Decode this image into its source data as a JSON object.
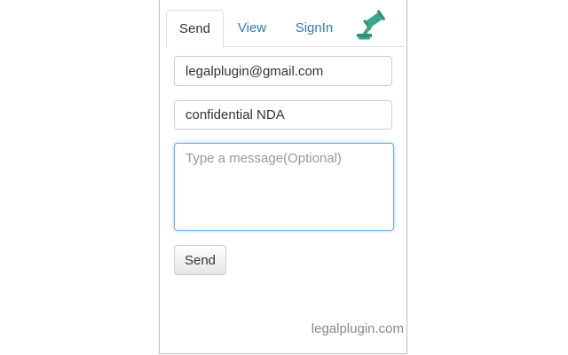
{
  "tabs": [
    {
      "label": "Send",
      "active": true
    },
    {
      "label": "View",
      "active": false
    },
    {
      "label": "SignIn",
      "active": false
    }
  ],
  "logo": {
    "icon": "gavel-icon",
    "color": "#3aa58d"
  },
  "form": {
    "email_value": "legalplugin@gmail.com",
    "subject_value": "confidential NDA",
    "message_placeholder": "Type a message(Optional)",
    "send_label": "Send"
  },
  "footer": {
    "text": "legalplugin.com"
  },
  "colors": {
    "link": "#337ab7",
    "focus": "#66afe9",
    "brand": "#3aa58d"
  }
}
